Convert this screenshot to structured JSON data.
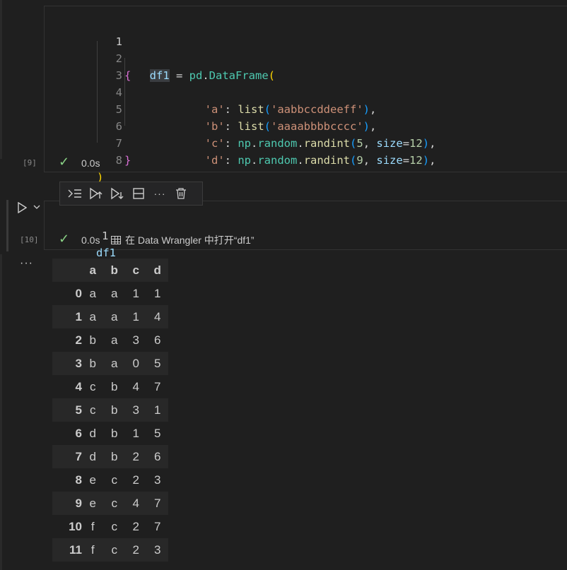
{
  "cell1": {
    "exec_count": "[9]",
    "duration": "0.0s",
    "lines": [
      {
        "n": "1"
      },
      {
        "n": "2"
      },
      {
        "n": "3"
      },
      {
        "n": "4"
      },
      {
        "n": "5"
      },
      {
        "n": "6"
      },
      {
        "n": "7"
      },
      {
        "n": "8"
      }
    ],
    "code": {
      "l1_var": "df1",
      "l1_eq": " = ",
      "l1_mod": "pd",
      "l1_dot": ".",
      "l1_fn": "DataFrame",
      "l1_paren": "(",
      "l2_brace": "{",
      "l3_key": "'a'",
      "l3_colon": ": ",
      "l3_fn": "list",
      "l3_p": "(",
      "l3_str": "'aabbccddeeff'",
      "l3_p2": ")",
      "l3_comma": ",",
      "l4_key": "'b'",
      "l4_colon": ": ",
      "l4_fn": "list",
      "l4_p": "(",
      "l4_str": "'aaaabbbbcccc'",
      "l4_p2": ")",
      "l4_comma": ",",
      "l5_key": "'c'",
      "l5_colon": ": ",
      "l5_mod": "np",
      "l5_d1": ".",
      "l5_random": "random",
      "l5_d2": ".",
      "l5_fn": "randint",
      "l5_p": "(",
      "l5_num": "5",
      "l5_sep": ", ",
      "l5_kw": "size",
      "l5_eq": "=",
      "l5_num2": "12",
      "l5_p2": ")",
      "l5_comma": ",",
      "l6_key": "'d'",
      "l6_colon": ": ",
      "l6_mod": "np",
      "l6_d1": ".",
      "l6_random": "random",
      "l6_d2": ".",
      "l6_fn": "randint",
      "l6_p": "(",
      "l6_num": "9",
      "l6_sep": ", ",
      "l6_kw": "size",
      "l6_eq": "=",
      "l6_num2": "12",
      "l6_p2": ")",
      "l6_comma": ",",
      "l7_brace": "}",
      "l8_paren": ")"
    }
  },
  "toolbar": {
    "buttons": [
      "run-by-line-icon",
      "execute-above-icon",
      "execute-below-icon",
      "split-cell-icon",
      "more-actions-icon",
      "delete-icon"
    ],
    "glyph_more": "···"
  },
  "cell2": {
    "exec_count": "[10]",
    "duration": "0.0s",
    "line_number": "1",
    "code_var": "df1",
    "wrangler_label": "在 Data Wrangler 中打开“df1”",
    "output_menu": "···"
  },
  "table": {
    "columns": [
      "a",
      "b",
      "c",
      "d"
    ],
    "rows": [
      {
        "idx": "0",
        "a": "a",
        "b": "a",
        "c": "1",
        "d": "1"
      },
      {
        "idx": "1",
        "a": "a",
        "b": "a",
        "c": "1",
        "d": "4"
      },
      {
        "idx": "2",
        "a": "b",
        "b": "a",
        "c": "3",
        "d": "6"
      },
      {
        "idx": "3",
        "a": "b",
        "b": "a",
        "c": "0",
        "d": "5"
      },
      {
        "idx": "4",
        "a": "c",
        "b": "b",
        "c": "4",
        "d": "7"
      },
      {
        "idx": "5",
        "a": "c",
        "b": "b",
        "c": "3",
        "d": "1"
      },
      {
        "idx": "6",
        "a": "d",
        "b": "b",
        "c": "1",
        "d": "5"
      },
      {
        "idx": "7",
        "a": "d",
        "b": "b",
        "c": "2",
        "d": "6"
      },
      {
        "idx": "8",
        "a": "e",
        "b": "c",
        "c": "2",
        "d": "3"
      },
      {
        "idx": "9",
        "a": "e",
        "b": "c",
        "c": "4",
        "d": "7"
      },
      {
        "idx": "10",
        "a": "f",
        "b": "c",
        "c": "2",
        "d": "7"
      },
      {
        "idx": "11",
        "a": "f",
        "b": "c",
        "c": "2",
        "d": "3"
      }
    ]
  }
}
